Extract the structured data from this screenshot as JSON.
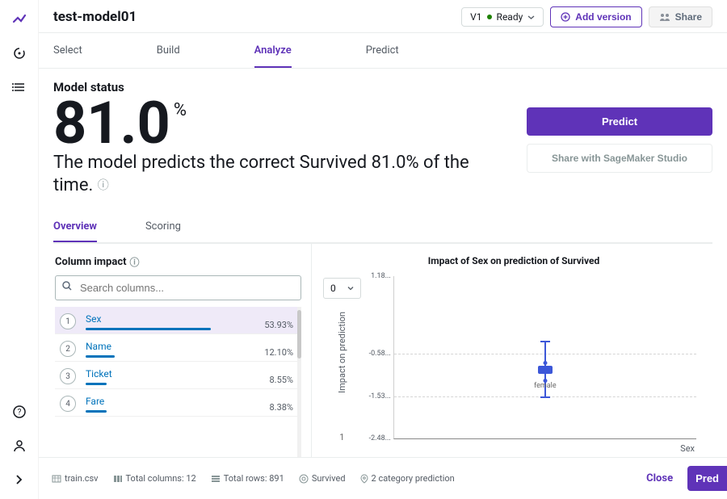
{
  "header": {
    "title": "test-model01",
    "version_label": "V1",
    "ready_label": "Ready",
    "add_version": "Add version",
    "share": "Share"
  },
  "tabs": {
    "select": "Select",
    "build": "Build",
    "analyze": "Analyze",
    "predict": "Predict"
  },
  "status": {
    "title": "Model status",
    "value": "81.0",
    "pct_sign": "%",
    "description": "The model predicts the correct Survived 81.0% of the time.",
    "predict_btn": "Predict",
    "share_btn": "Share with SageMaker Studio"
  },
  "subtabs": {
    "overview": "Overview",
    "scoring": "Scoring"
  },
  "column_impact": {
    "title": "Column impact",
    "search_placeholder": "Search columns...",
    "items": [
      {
        "rank": "1",
        "name": "Sex",
        "pct": "53.93%",
        "bar_pct": 53.93
      },
      {
        "rank": "2",
        "name": "Name",
        "pct": "12.10%",
        "bar_pct": 12.1
      },
      {
        "rank": "3",
        "name": "Ticket",
        "pct": "8.55%",
        "bar_pct": 8.55
      },
      {
        "rank": "4",
        "name": "Fare",
        "pct": "8.38%",
        "bar_pct": 8.38
      }
    ]
  },
  "chart": {
    "title": "Impact of Sex on prediction of Survived",
    "ylabel": "Impact on prediction",
    "xlabel": "Sex",
    "dropdown": "0",
    "category_label": "female",
    "y_one": "1"
  },
  "chart_data": {
    "type": "scatter",
    "title": "Impact of Sex on prediction of Survived",
    "xlabel": "Sex",
    "ylabel": "Impact on prediction",
    "categories": [
      "female"
    ],
    "ylim": [
      -2.48,
      1.18
    ],
    "y_ticks": [
      1.18,
      -0.58,
      -1.53,
      -2.48
    ],
    "series": [
      {
        "name": "female",
        "median": -0.95,
        "q1": -1.0,
        "q3": -0.9,
        "whisker_low": -1.53,
        "whisker_high": -0.4
      }
    ]
  },
  "footer": {
    "file": "train.csv",
    "cols": "Total columns: 12",
    "rows": "Total rows: 891",
    "target": "Survived",
    "type": "2 category prediction",
    "close": "Close",
    "predict": "Pred"
  }
}
